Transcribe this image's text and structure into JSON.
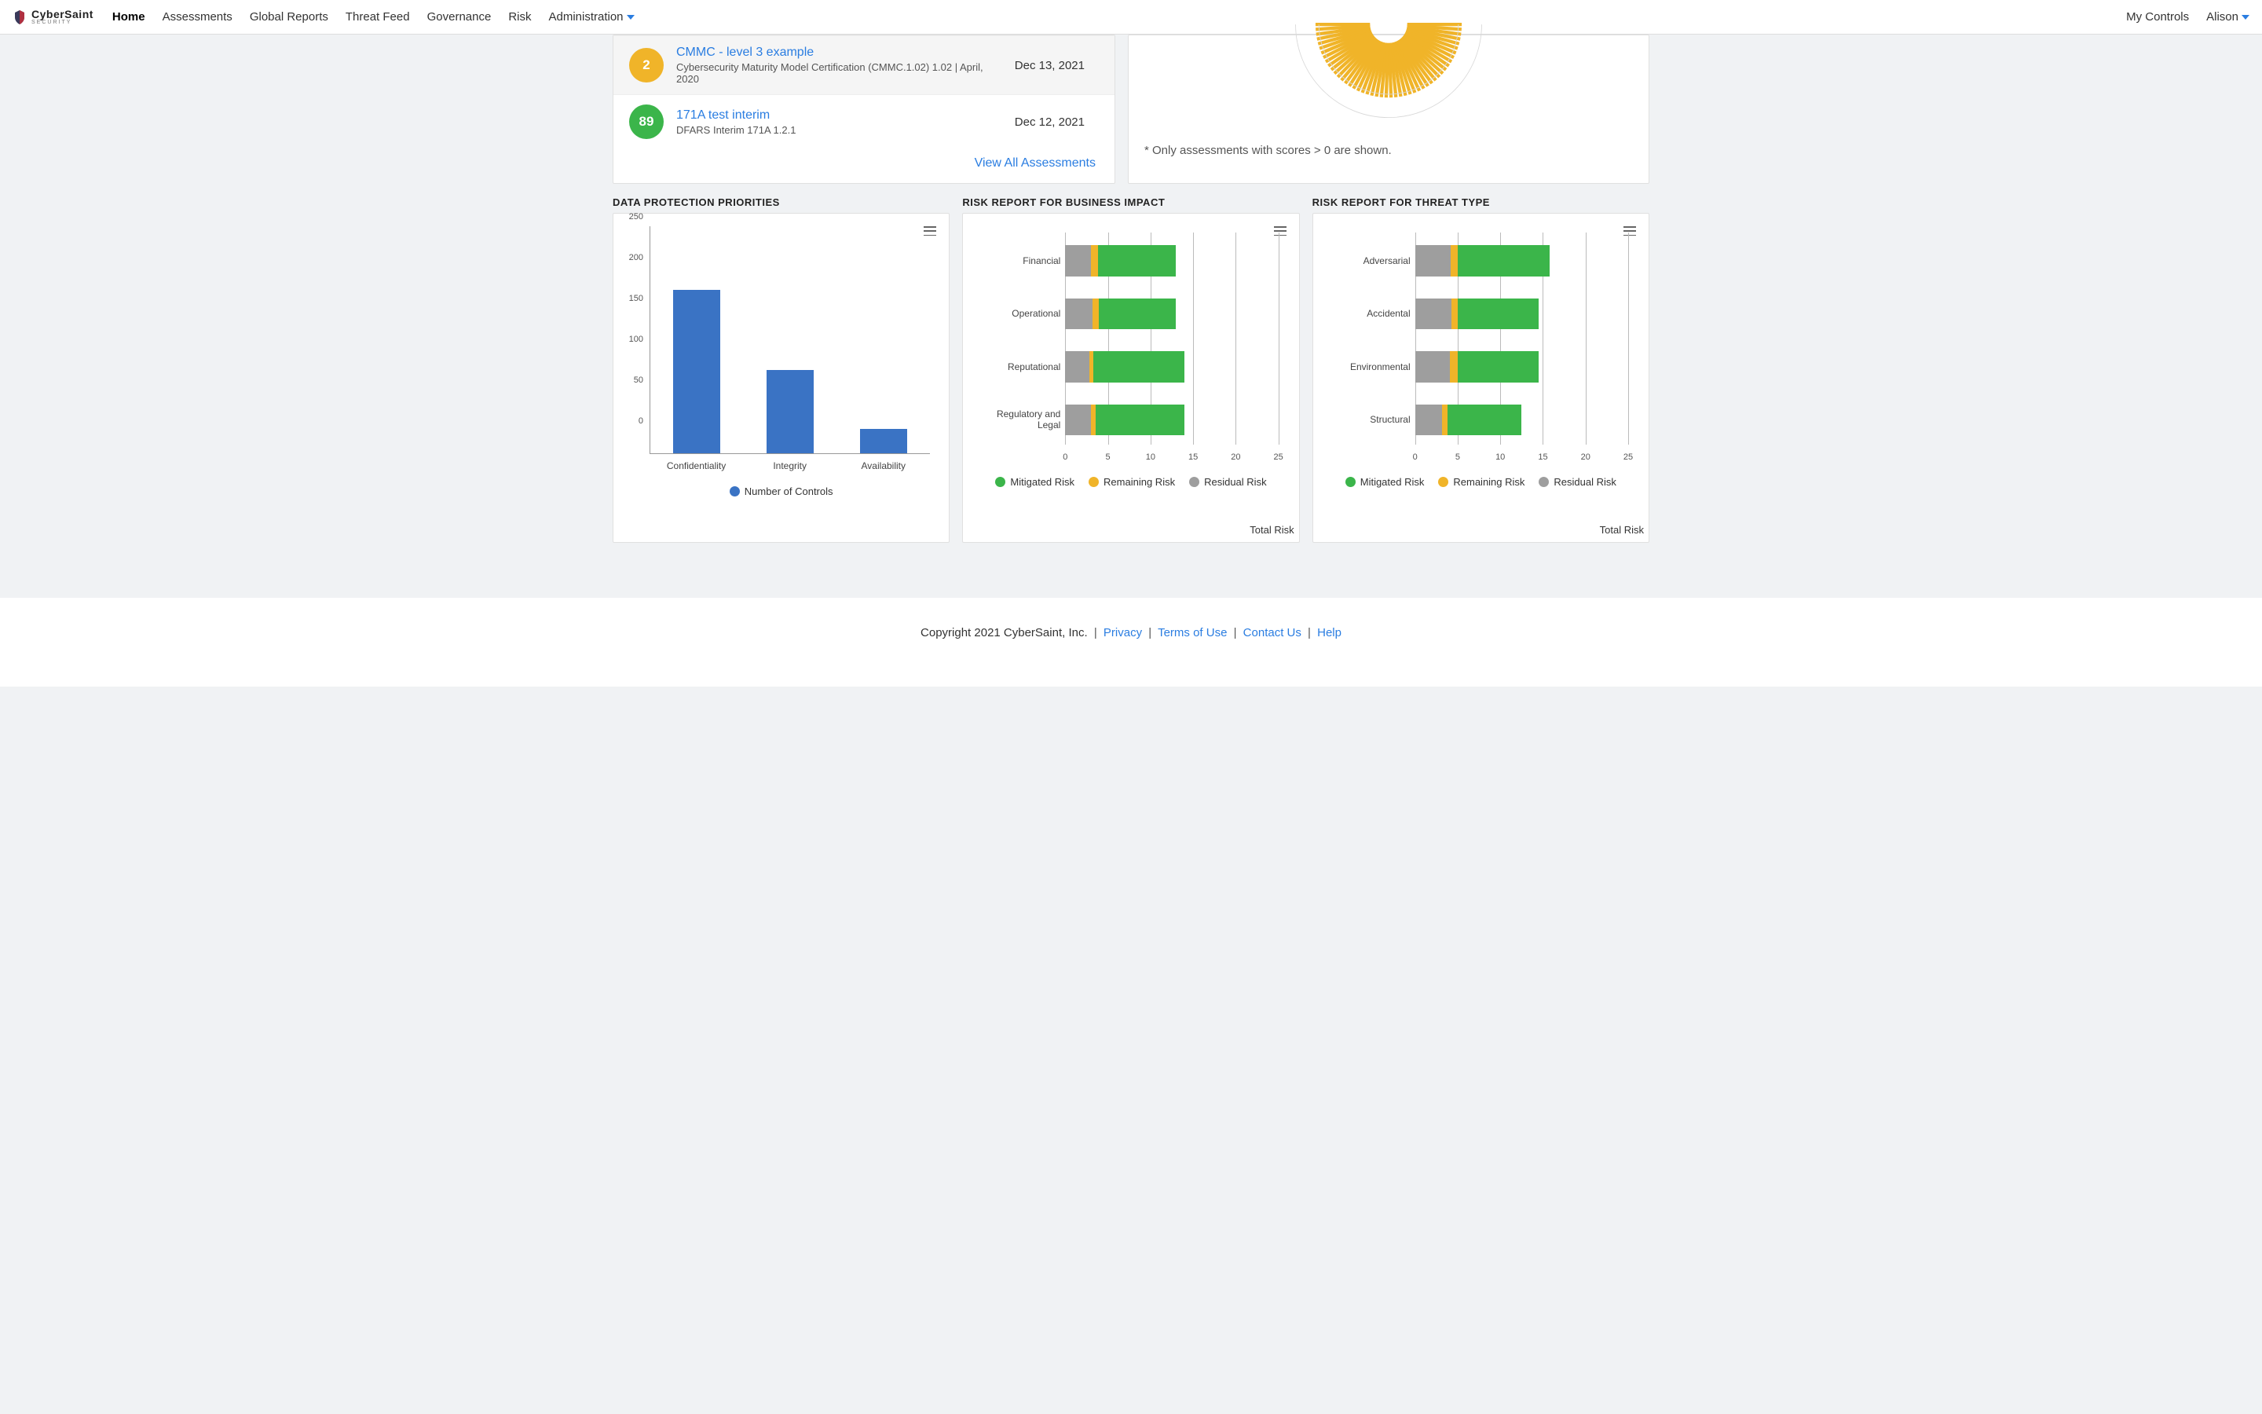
{
  "brand": {
    "name": "CyberSaint",
    "subtitle": "SECURITY"
  },
  "nav": {
    "items": [
      "Home",
      "Assessments",
      "Global Reports",
      "Threat Feed",
      "Governance",
      "Risk",
      "Administration"
    ],
    "active_index": 0,
    "right": {
      "my_controls": "My Controls",
      "user": "Alison"
    }
  },
  "assessments": {
    "items": [
      {
        "score": 2,
        "color": "yellow",
        "title": "CMMC - level 3 example",
        "subtitle": "Cybersecurity Maturity Model Certification (CMMC.1.02) 1.02 | April, 2020",
        "date": "Dec 13, 2021",
        "highlight": true
      },
      {
        "score": 89,
        "color": "green",
        "title": "171A test interim",
        "subtitle": "DFARS Interim 171A 1.2.1",
        "date": "Dec 12, 2021",
        "highlight": false
      }
    ],
    "view_all": "View All Assessments"
  },
  "sunburst_footnote": "* Only assessments with scores > 0 are shown.",
  "chart_titles": {
    "data_protection": "DATA PROTECTION PRIORITIES",
    "business_impact": "RISK REPORT FOR BUSINESS IMPACT",
    "threat_type": "RISK REPORT FOR THREAT TYPE"
  },
  "legends": {
    "bar": [
      {
        "label": "Number of Controls",
        "color": "#3a73c4"
      }
    ],
    "risk": [
      {
        "label": "Mitigated Risk",
        "color": "#3bb54a"
      },
      {
        "label": "Remaining Risk",
        "color": "#f0b429"
      },
      {
        "label": "Residual Risk",
        "color": "#9e9e9e"
      }
    ]
  },
  "axis_labels": {
    "total_risk": "Total Risk"
  },
  "chart_data": [
    {
      "id": "data_protection",
      "type": "bar",
      "title": "DATA PROTECTION PRIORITIES",
      "ylabel": "",
      "xlabel": "",
      "ylim": [
        0,
        250
      ],
      "yticks": [
        0,
        50,
        100,
        150,
        200,
        250
      ],
      "categories": [
        "Confidentiality",
        "Integrity",
        "Availability"
      ],
      "series": [
        {
          "name": "Number of Controls",
          "values": [
            200,
            102,
            30
          ],
          "color": "#3a73c4"
        }
      ]
    },
    {
      "id": "business_impact",
      "type": "stacked-bar-horizontal",
      "title": "RISK REPORT FOR BUSINESS IMPACT",
      "xlabel": "Total Risk",
      "xlim": [
        0,
        25
      ],
      "xticks": [
        0,
        5,
        10,
        15,
        20,
        25
      ],
      "categories": [
        "Financial",
        "Operational",
        "Reputational",
        "Regulatory and Legal"
      ],
      "series": [
        {
          "name": "Residual Risk",
          "color": "#9e9e9e",
          "values": [
            3.0,
            3.2,
            2.8,
            3.0
          ]
        },
        {
          "name": "Remaining Risk",
          "color": "#f0b429",
          "values": [
            0.8,
            0.7,
            0.5,
            0.6
          ]
        },
        {
          "name": "Mitigated Risk",
          "color": "#3bb54a",
          "values": [
            9.2,
            9.1,
            10.7,
            10.4
          ]
        }
      ]
    },
    {
      "id": "threat_type",
      "type": "stacked-bar-horizontal",
      "title": "RISK REPORT FOR THREAT TYPE",
      "xlabel": "Total Risk",
      "xlim": [
        0,
        25
      ],
      "xticks": [
        0,
        5,
        10,
        15,
        20,
        25
      ],
      "categories": [
        "Adversarial",
        "Accidental",
        "Environmental",
        "Structural"
      ],
      "series": [
        {
          "name": "Residual Risk",
          "color": "#9e9e9e",
          "values": [
            4.2,
            4.3,
            4.1,
            3.2
          ]
        },
        {
          "name": "Remaining Risk",
          "color": "#f0b429",
          "values": [
            0.8,
            0.7,
            0.9,
            0.6
          ]
        },
        {
          "name": "Mitigated Risk",
          "color": "#3bb54a",
          "values": [
            10.8,
            9.5,
            9.5,
            8.7
          ]
        }
      ]
    }
  ],
  "footer": {
    "copyright": "Copyright 2021 CyberSaint, Inc.",
    "links": {
      "privacy": "Privacy",
      "terms": "Terms of Use",
      "contact": "Contact Us",
      "help": "Help"
    }
  }
}
